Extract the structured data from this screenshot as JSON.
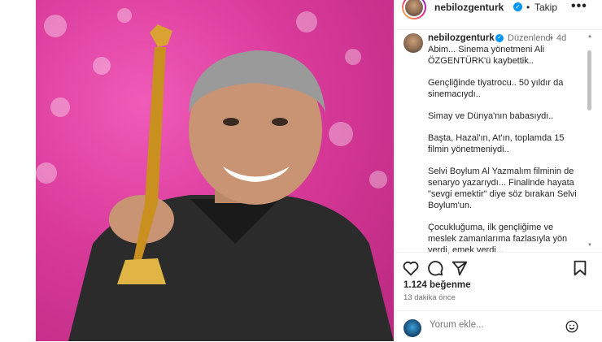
{
  "header": {
    "username": "nebilozgenturk",
    "separator": "•",
    "follow_label": "Takip",
    "more_label": "•••"
  },
  "post": {
    "username": "nebilozgenturk",
    "edited_label": "Düzenlendi",
    "meta_dot": "•",
    "age": "4d",
    "caption": [
      "Abim... Sinema yönetmeni Ali ÖZGENTÜRK'ü kaybettik..",
      "Gençliğinde tiyatrocu.. 50 yıldır da sinemacıydı..",
      "Simay ve Dünya'nın babasıydı..",
      "Başta, Hazal'ın, At'ın, toplamda 15 filmin yönetmeniydi..",
      "Selvi Boylum Al Yazmalım filminin de senaryo yazarıydı... Finalinde hayata \"sevgi emektir\" diye söz bırakan Selvi Boylum'un.",
      "Çocukluğuma, ilk gençliğime ve meslek zamanlarıma fazlasıyla yön verdi, emek verdi..."
    ]
  },
  "stats": {
    "likes": "1.124 beğenme",
    "time": "13 dakika önce"
  },
  "comment": {
    "placeholder": "Yorum ekle..."
  },
  "colors": {
    "verified": "#0095f6",
    "photo_bg": "#d93a9a"
  },
  "icons": {
    "like": "heart-icon",
    "comment": "comment-icon",
    "share": "paper-plane-icon",
    "save": "bookmark-icon",
    "emoji": "smiley-icon"
  }
}
